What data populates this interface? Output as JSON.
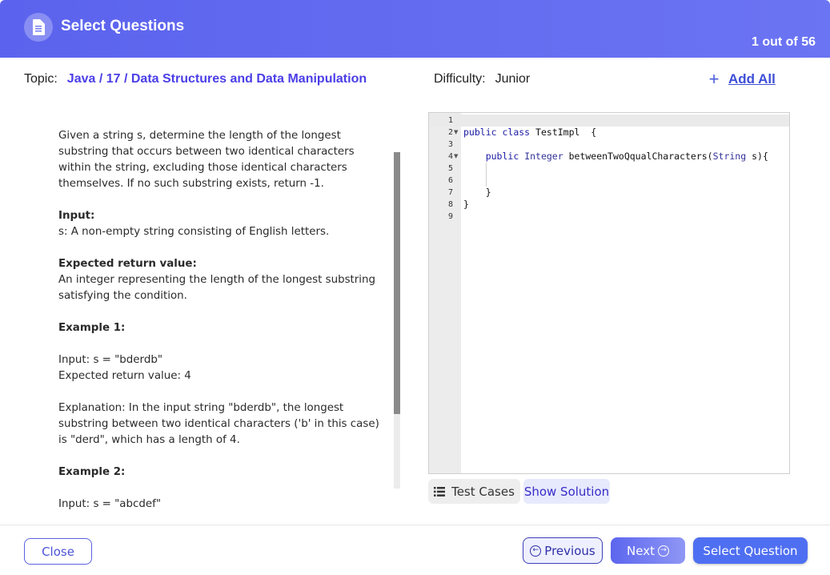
{
  "header": {
    "title": "Select Questions",
    "counter": "1 out of 56",
    "icon": "document-icon"
  },
  "meta": {
    "topic_label": "Topic:",
    "topic_value": "Java / 17 / Data Structures and Data Manipulation",
    "difficulty_label": "Difficulty:",
    "difficulty_value": "Junior",
    "add_all_label": "Add All"
  },
  "description": {
    "intro": "Given a string s, determine the length of the longest substring that occurs between two identical characters within the string, excluding those identical characters themselves. If no such substring exists, return -1.",
    "input_heading": "Input:",
    "input_text": "s: A non-empty string consisting of English letters.",
    "expected_heading": "Expected return value:",
    "expected_text": "An integer representing the length of the longest substring satisfying the condition.",
    "example1_heading": "Example 1:",
    "example1_input": "Input: s = \"bderdb\"",
    "example1_output": "Expected return value: 4",
    "example1_explanation": "Explanation: In the input string \"bderdb\", the longest substring between two identical characters ('b' in this case) is \"derd\", which has a length of 4.",
    "example2_heading": "Example 2:",
    "example2_input": "Input: s = \"abcdef\""
  },
  "editor": {
    "line_numbers": [
      "1",
      "2",
      "3",
      "4",
      "5",
      "6",
      "7",
      "8",
      "9"
    ],
    "line2_kw1": "public",
    "line2_kw2": "class",
    "line2_name": "TestImpl  {",
    "line4_kw": "public",
    "line4_type": "Integer",
    "line4_method": "betweenTwoQqualCharacters(",
    "line4_param_type": "String",
    "line4_rest": "s){",
    "line7": "}",
    "line8": "}"
  },
  "tabs": {
    "test_cases_label": "Test Cases",
    "show_solution_label": "Show Solution"
  },
  "footer": {
    "close_label": "Close",
    "previous_label": "Previous",
    "next_label": "Next",
    "select_label": "Select Question"
  },
  "colors": {
    "header": "#5b63ee",
    "accent": "#4b3ee6",
    "primary_button": "#4f6ff2"
  }
}
